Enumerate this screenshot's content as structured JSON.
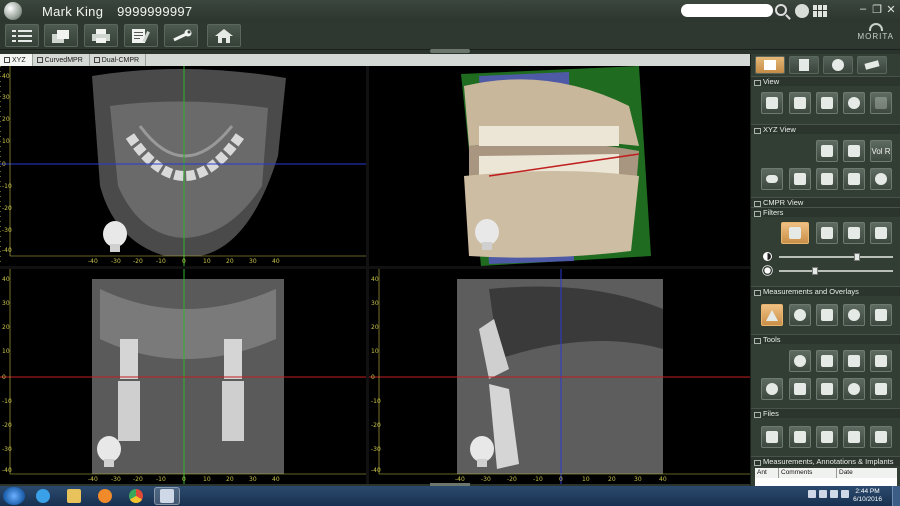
{
  "window": {
    "patient_name": "Mark  King",
    "patient_id": "9999999997",
    "brand": "MORITA",
    "controls": {
      "minimize": "‒",
      "restore": "❐",
      "close": "✕"
    }
  },
  "toolbar": {
    "buttons": [
      "patient-list-icon",
      "layout-icon",
      "print-icon",
      "report-icon",
      "settings-wrench-icon",
      "home-icon"
    ]
  },
  "view_tabs": [
    {
      "label": "XYZ",
      "active": true
    },
    {
      "label": "CurvedMPR",
      "active": false
    },
    {
      "label": "Dual-CMPR",
      "active": false
    }
  ],
  "viewports": {
    "scale_labels_x": [
      "-40",
      "-30",
      "-20",
      "-10",
      "0",
      "10",
      "20",
      "30",
      "40"
    ],
    "scale_labels_y": [
      "40",
      "30",
      "20",
      "10",
      "0",
      "-10",
      "-20",
      "-30",
      "-40"
    ],
    "colors": {
      "axis_green": "#2fb52f",
      "axis_blue": "#2a3ad0",
      "axis_red": "#c02020",
      "scale": "#c9c44a"
    }
  },
  "right_panel": {
    "tabs": [
      "view-tab-icon",
      "cut-tab-icon",
      "info-tab-icon",
      "tools-tab-icon"
    ],
    "sections": {
      "view": "View",
      "xyz_view": "XYZ View",
      "vol_r_label": "Vol R",
      "cmpr_view": "CMPR View",
      "filters": "Filters",
      "measurements": "Measurements and Overlays",
      "tools": "Tools",
      "files": "Files",
      "annotations": "Measurements, Annotations & Implants"
    },
    "table_headers": [
      "Ant",
      "Comments",
      "Date"
    ],
    "sliders": {
      "contrast": 0.68,
      "brightness": 0.32
    },
    "accent_color": "#d99f55"
  },
  "taskbar": {
    "time": "2:44 PM",
    "date": "6/10/2016",
    "apps": [
      "internet-explorer-icon",
      "file-explorer-icon",
      "media-player-icon",
      "chrome-icon",
      "imaging-app-icon"
    ]
  }
}
